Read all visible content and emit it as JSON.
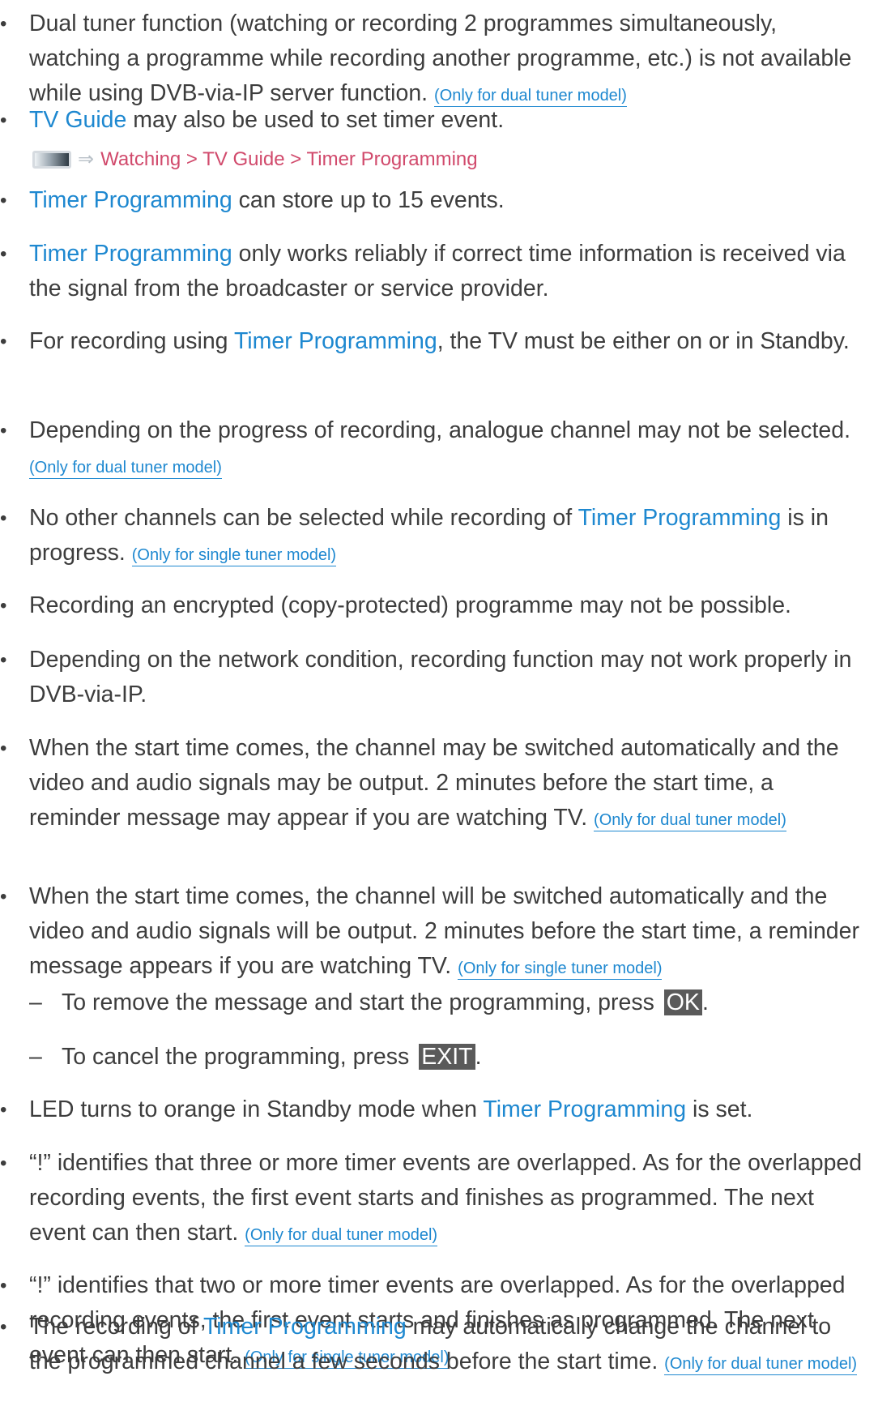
{
  "items": [
    {
      "id": "dual-tuner-function",
      "parts": [
        {
          "t": "Dual tuner function (watching or recording 2 programmes simultaneously, watching a programme while recording another programme, etc.) is not available while using DVB-via-IP server function. ",
          "cls": ""
        },
        {
          "t": "(Only for dual tuner model)",
          "cls": "note"
        }
      ]
    },
    {
      "id": "tv-guide",
      "parts": [
        {
          "t": "TV Guide",
          "cls": "link"
        },
        {
          "t": " may also be used to set timer event.",
          "cls": ""
        }
      ]
    },
    {
      "id": "store-events",
      "parts": [
        {
          "t": "Timer Programming",
          "cls": "link"
        },
        {
          "t": " can store up to 15 events.",
          "cls": ""
        }
      ]
    },
    {
      "id": "time-info",
      "parts": [
        {
          "t": "Timer Programming",
          "cls": "link"
        },
        {
          "t": " only works reliably if correct time information is received via the signal from the broadcaster or service provider.",
          "cls": ""
        }
      ]
    },
    {
      "id": "tv-standby",
      "parts": [
        {
          "t": "For recording using ",
          "cls": ""
        },
        {
          "t": "Timer Programming",
          "cls": "link"
        },
        {
          "t": ", the TV must be either on or in Standby.",
          "cls": ""
        }
      ]
    },
    {
      "id": "analogue-channel",
      "parts": [
        {
          "t": "Depending on the progress of recording, analogue channel may not be selected. ",
          "cls": ""
        },
        {
          "t": "(Only for dual tuner model)",
          "cls": "note"
        }
      ]
    },
    {
      "id": "no-other-channels",
      "parts": [
        {
          "t": "No other channels can be selected while recording of ",
          "cls": ""
        },
        {
          "t": "Timer Programming",
          "cls": "link"
        },
        {
          "t": " is in progress. ",
          "cls": ""
        },
        {
          "t": "(Only for single tuner model)",
          "cls": "note"
        }
      ]
    },
    {
      "id": "encrypted",
      "parts": [
        {
          "t": "Recording an encrypted (copy-protected) programme may not be possible.",
          "cls": ""
        }
      ]
    },
    {
      "id": "network-condition",
      "parts": [
        {
          "t": "Depending on the network condition, recording function may not work properly in DVB-via-IP.",
          "cls": ""
        }
      ]
    },
    {
      "id": "start-time-dual",
      "parts": [
        {
          "t": "When the start time comes, the channel may be switched automatically and the video and audio signals may be output. 2 minutes before the start time, a reminder message may appear if you are watching TV. ",
          "cls": ""
        },
        {
          "t": "(Only for dual tuner model)",
          "cls": "note note-wrap"
        }
      ]
    },
    {
      "id": "start-time-single",
      "parts": [
        {
          "t": "When the start time comes, the channel will be switched automatically and the video and audio signals will be output. 2 minutes before the start time, a reminder message appears if you are watching TV. ",
          "cls": ""
        },
        {
          "t": "(Only for single tuner model)",
          "cls": "note"
        }
      ]
    },
    {
      "id": "led-orange",
      "parts": [
        {
          "t": "LED turns to orange in Standby mode when ",
          "cls": ""
        },
        {
          "t": "Timer Programming",
          "cls": "link"
        },
        {
          "t": " is set.",
          "cls": ""
        }
      ]
    },
    {
      "id": "overlap-three",
      "parts": [
        {
          "t": "“!” identifies that three or more timer events are overlapped. As for the overlapped recording events, the first event starts and finishes as programmed. The next event can then start. ",
          "cls": ""
        },
        {
          "t": "(Only for dual tuner model)",
          "cls": "note"
        }
      ]
    },
    {
      "id": "overlap-two",
      "parts": [
        {
          "t": "“!” identifies that two or more timer events are overlapped. As for the overlapped recording events, the first event starts and finishes as programmed. The next event can then start. ",
          "cls": ""
        },
        {
          "t": "(Only for single tuner model)",
          "cls": "note"
        }
      ]
    },
    {
      "id": "auto-change",
      "parts": [
        {
          "t": "The recording of ",
          "cls": ""
        },
        {
          "t": "Timer Programming",
          "cls": "link"
        },
        {
          "t": " may automatically change the channel to the programmed channel a few seconds before the start time. ",
          "cls": ""
        },
        {
          "t": "(Only for dual tuner model)",
          "cls": "note"
        }
      ]
    }
  ],
  "subitems": [
    {
      "id": "remove-message",
      "parts": [
        {
          "t": "To remove the message and start the programming, press ",
          "cls": ""
        },
        {
          "t": "OK",
          "cls": "key"
        },
        {
          "t": ".",
          "cls": ""
        }
      ]
    },
    {
      "id": "cancel-programming",
      "parts": [
        {
          "t": "To cancel the programming, press ",
          "cls": ""
        },
        {
          "t": "EXIT",
          "cls": "key"
        },
        {
          "t": ".",
          "cls": ""
        }
      ]
    }
  ],
  "path": {
    "icon": "menu-icon",
    "text": "Watching > TV Guide > Timer Programming"
  }
}
